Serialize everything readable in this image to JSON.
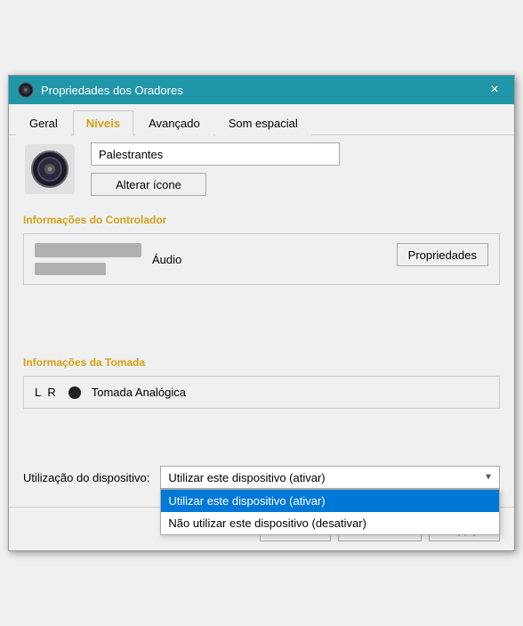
{
  "dialog": {
    "title": "Propriedades dos Oradores",
    "close_label": "×"
  },
  "tabs": [
    {
      "id": "geral",
      "label": "Geral",
      "active": false
    },
    {
      "id": "niveis",
      "label": "Níveis",
      "active": true
    },
    {
      "id": "avancado",
      "label": "Avançado",
      "active": false
    },
    {
      "id": "som_espacial",
      "label": "Som espacial",
      "active": false
    }
  ],
  "device_name": "Palestrantes",
  "change_icon_label": "Alterar ícone",
  "controller_section_label": "Informações do Controlador",
  "controller_name": "Áudio",
  "properties_btn_label": "Propriedades",
  "jack_section_label": "Informações da Tomada",
  "jack_lr": "L R",
  "jack_type": "Tomada Analógica",
  "device_usage_label": "Utilização do dispositivo:",
  "dropdown": {
    "selected": "Utilizar este dispositivo (ativar)",
    "options": [
      {
        "label": "Utilizar este dispositivo (ativar)",
        "selected": true
      },
      {
        "label": "Não utilizar este dispositivo (desativar)",
        "selected": false
      }
    ]
  },
  "footer": {
    "ok_label": "OK",
    "cancel_label": "Cancelar",
    "apply_label": "Apply"
  }
}
